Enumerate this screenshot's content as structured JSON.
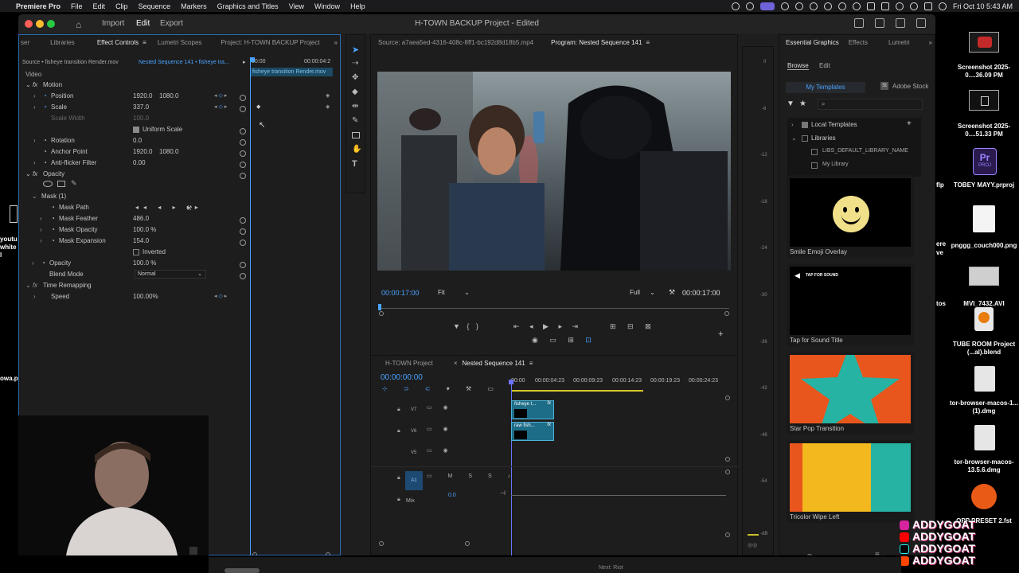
{
  "menubar": {
    "app": "Premiere Pro",
    "items": [
      "File",
      "Edit",
      "Clip",
      "Sequence",
      "Markers",
      "Graphics and Titles",
      "View",
      "Window",
      "Help"
    ],
    "clock": "Fri Oct 10  5:43 AM"
  },
  "window": {
    "tabs": [
      "Import",
      "Edit",
      "Export"
    ],
    "active_tab": "Edit",
    "title": "H-TOWN BACKUP Project - Edited"
  },
  "effect_controls": {
    "tabs": [
      "ser",
      "Libraries",
      "Effect Controls",
      "Lumetri Scopes",
      "Project: H-TOWN BACKUP Project"
    ],
    "source": "Source • fisheye transition Render.mov",
    "sequence": "Nested Sequence 141 • fisheye tra...",
    "time_start": "00:00",
    "time_end": "00:00:04:2",
    "clip_bar": "fisheye transition Render.mov",
    "video_label": "Video",
    "rows": {
      "motion": "Motion",
      "position": "Position",
      "position_x": "1920.0",
      "position_y": "1080.0",
      "scale": "Scale",
      "scale_val": "337.0",
      "scale_width": "Scale Width",
      "scale_width_val": "100.0",
      "uniform_scale": "Uniform Scale",
      "rotation": "Rotation",
      "rotation_val": "0.0",
      "anchor": "Anchor Point",
      "anchor_x": "1920.0",
      "anchor_y": "1080.0",
      "antiflicker": "Anti-flicker Filter",
      "antiflicker_val": "0.00",
      "opacity_group": "Opacity",
      "mask": "Mask (1)",
      "mask_path": "Mask Path",
      "mask_feather": "Mask Feather",
      "mask_feather_val": "486.0",
      "mask_opacity": "Mask Opacity",
      "mask_opacity_val": "100.0 %",
      "mask_expansion": "Mask Expansion",
      "mask_expansion_val": "154.0",
      "inverted": "Inverted",
      "opacity": "Opacity",
      "opacity_val": "100.0 %",
      "blend_mode": "Blend Mode",
      "blend_mode_val": "Normal",
      "time_remap": "Time Remapping",
      "speed": "Speed",
      "speed_val": "100.00%"
    }
  },
  "source_monitor": {
    "title": "Source: a7aea5ed-4316-408c-8ff1-bc192d8d18b5.mp4"
  },
  "program_monitor": {
    "title": "Program: Nested Sequence 141",
    "timecode_left": "00:00:17:00",
    "fit": "Fit",
    "quality": "Full",
    "timecode_right": "00:00:17:00"
  },
  "timeline": {
    "tabs": [
      "H-TOWN Project",
      "Nested Sequence 141"
    ],
    "timecode": "00:00:00:00",
    "ruler": [
      "00:00",
      "00:00:04:23",
      "00:00:09:23",
      "00:00:14:23",
      "00:00:19:23",
      "00:00:24:23"
    ],
    "tracks": [
      "V7",
      "V6",
      "V5",
      "A1"
    ],
    "mix_label": "Mix",
    "mix_val": "0.0",
    "clips": [
      {
        "label": "fisheye t..."
      },
      {
        "label": "raw fish..."
      }
    ],
    "meter_ticks": [
      "0",
      "-6",
      "-12",
      "-18",
      "-24",
      "-30",
      "-36",
      "-42",
      "-48",
      "-54",
      "-dB"
    ]
  },
  "essential_graphics": {
    "tabs": [
      "Essential Graphics",
      "Effects",
      "Lumetri"
    ],
    "sub_tabs": [
      "Browse",
      "Edit"
    ],
    "mode_tabs": [
      "My Templates",
      "Adobe Stock"
    ],
    "tree": [
      "Local Templates",
      "Libraries",
      "LIBS_DEFAULT_LIBRARY_NAME",
      "My Library"
    ],
    "templates": [
      {
        "name": "Smile Emoji Overlay"
      },
      {
        "name": "Tap for Sound Title",
        "text": "TAP FOR SOUND"
      },
      {
        "name": "Star Pop Transition"
      },
      {
        "name": "Tricolor Wipe Left"
      }
    ]
  },
  "desktop": {
    "icons": [
      {
        "label": "Screenshot 2025-0....36.09 PM"
      },
      {
        "label": "Screenshot 2025-0....51.33 PM"
      },
      {
        "label": "TOBEY MAYY.prproj",
        "badge": "Pr",
        "sub": "PROJ"
      },
      {
        "label": "pnggg_couch000.png"
      },
      {
        "label": "MVI_7432.AVI"
      },
      {
        "label": "TUBE ROOM Project (...al).blend"
      },
      {
        "label": "tor-browser-macos-1...(1).dmg"
      },
      {
        "label": "tor-browser-macos-13.5.6.dmg"
      },
      {
        "label": "OPP PRESET 2.fst"
      }
    ],
    "left_fragments": [
      "flp",
      "youtu",
      "white l",
      "ere",
      "ve",
      "tos",
      "owa.p"
    ],
    "watermark": [
      "ADDYGOAT",
      "ADDYGOAT",
      "ADDYGOAT",
      "ADDYGOAT"
    ],
    "dock_text": "Next: Riot"
  },
  "colors": {
    "accent": "#4aa3ff",
    "clip": "#1e6d88",
    "playhead": "#6b74ff"
  }
}
